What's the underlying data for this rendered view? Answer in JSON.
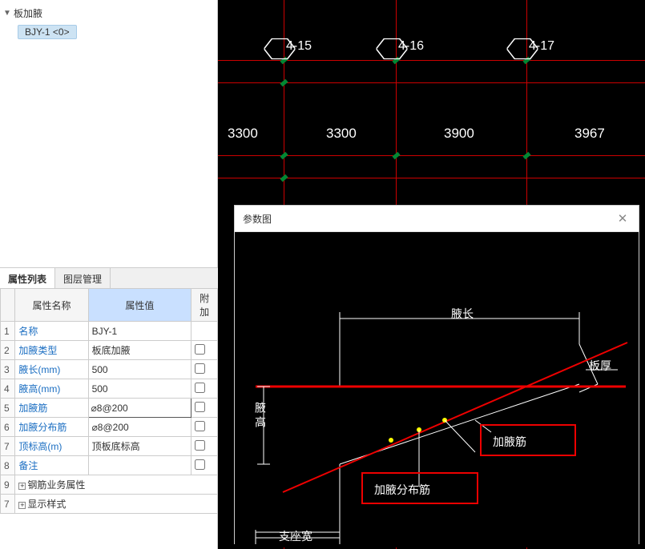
{
  "tree": {
    "root": "板加腋",
    "child": "BJY-1 <0>"
  },
  "tabs": {
    "attr": "属性列表",
    "layer": "图层管理"
  },
  "headers": {
    "name": "属性名称",
    "value": "属性值",
    "extra": "附加"
  },
  "rows": [
    {
      "n": "1",
      "name": "名称",
      "value": "BJY-1"
    },
    {
      "n": "2",
      "name": "加腋类型",
      "value": "板底加腋"
    },
    {
      "n": "3",
      "name": "腋长(mm)",
      "value": "500"
    },
    {
      "n": "4",
      "name": "腋高(mm)",
      "value": "500"
    },
    {
      "n": "5",
      "name": "加腋筋",
      "value": "⌀8@200",
      "selected": true
    },
    {
      "n": "6",
      "name": "加腋分布筋",
      "value": "⌀8@200"
    },
    {
      "n": "7",
      "name": "顶标高(m)",
      "value": "顶板底标高"
    },
    {
      "n": "8",
      "name": "备注",
      "value": ""
    },
    {
      "n": "9",
      "name": "钢筋业务属性",
      "expandable": true
    },
    {
      "n": "7",
      "name": "显示样式",
      "expandable": true
    }
  ],
  "axes": [
    "4-15",
    "4-16",
    "4-17"
  ],
  "dims": [
    "3300",
    "3300",
    "3900",
    "3967"
  ],
  "dialog": {
    "title": "参数图",
    "labels": {
      "yechang": "腋长",
      "banhou": "板厚",
      "yegao": "腋高",
      "jyj": "加腋筋",
      "jyfbj": "加腋分布筋",
      "zzk": "支座宽"
    }
  }
}
